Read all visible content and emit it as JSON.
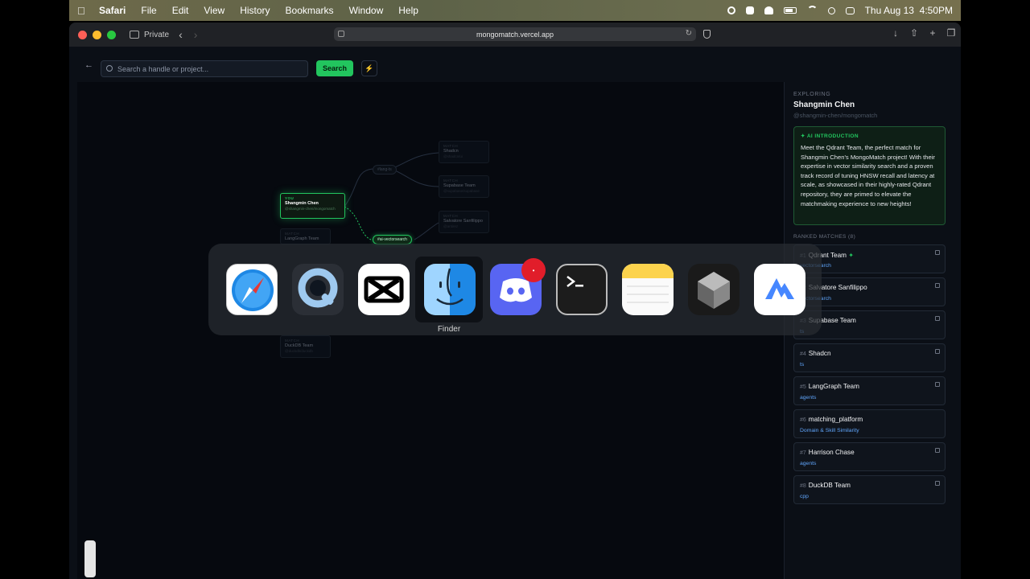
{
  "menubar": {
    "app_name": "Safari",
    "items": [
      "File",
      "Edit",
      "View",
      "History",
      "Bookmarks",
      "Window",
      "Help"
    ],
    "clock": "Thu Aug 13  4:50PM"
  },
  "browser": {
    "private_label": "Private",
    "url": "mongomatch.vercel.app"
  },
  "search": {
    "placeholder": "Search a handle or project...",
    "button_label": "Search"
  },
  "graph": {
    "you_node": {
      "kicker": "YOU",
      "name": "Shangmin Chen",
      "handle": "@shangmin-chen/mongomatch"
    },
    "match_nodes": [
      {
        "kicker": "MATCH",
        "name": "Shadcn",
        "handle": "@shadcn/ui"
      },
      {
        "kicker": "MATCH",
        "name": "Supabase Team",
        "handle": "@supabase/supabase"
      },
      {
        "kicker": "MATCH",
        "name": "Salvatore Sanfilippo",
        "handle": "@antirez"
      },
      {
        "kicker": "MATCH",
        "name": "LangGraph Team",
        "handle": ""
      },
      {
        "kicker": "MATCH",
        "name": "DuckDB Team",
        "handle": "@duckdb/duckdb"
      }
    ],
    "tags": {
      "vector": "#ai-vectorsearch",
      "lang": "#lang-ts"
    }
  },
  "panel": {
    "exploring_label": "EXPLORING",
    "name": "Shangmin Chen",
    "handle": "@shangmin-chen/mongomatch",
    "ai_title": "AI INTRODUCTION",
    "ai_text": "Meet the Qdrant Team, the perfect match for Shangmin Chen's MongoMatch project! With their expertise in vector similarity search and a proven track record of tuning HNSW recall and latency at scale, as showcased in their highly-rated Qdrant repository, they are primed to elevate the matchmaking experience to new heights!",
    "ranked_label": "RANKED MATCHES (8)",
    "matches": [
      {
        "rank": "#1",
        "name": "Qdrant Team",
        "sub": "vectorsearch"
      },
      {
        "rank": "#2",
        "name": "Salvatore Sanfilippo",
        "sub": "vectorsearch"
      },
      {
        "rank": "#3",
        "name": "Supabase Team",
        "sub": "ts"
      },
      {
        "rank": "#4",
        "name": "Shadcn",
        "sub": "ts"
      },
      {
        "rank": "#5",
        "name": "LangGraph Team",
        "sub": "agents"
      },
      {
        "rank": "#6",
        "name": "matching_platform",
        "sub": "Domain & Skill Similarity"
      },
      {
        "rank": "#7",
        "name": "Harrison Chase",
        "sub": "agents"
      },
      {
        "rank": "#8",
        "name": "DuckDB Team",
        "sub": "cpp"
      }
    ]
  },
  "switcher": {
    "selected_label": "Finder",
    "apps": [
      "Safari",
      "QuickTime Player",
      "CapCut",
      "Finder",
      "Discord",
      "Terminal",
      "Notes",
      "Unity Hub",
      "NordVPN"
    ],
    "discord_badge": "•"
  }
}
